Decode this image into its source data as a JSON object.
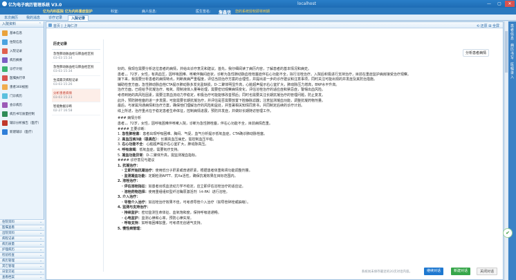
{
  "window": {
    "title": "亿为电子病历管理系统 V3.0",
    "host": "localhost",
    "controls": [
      "—",
      "▢",
      "✕"
    ]
  },
  "toolbar": {
    "org": "亿为内科医院 亿为内科重症监护",
    "ward_label": "科室:",
    "patient_label": "病人信息:",
    "doctor_label": "医生签名:",
    "user": "詹鑫信",
    "warning": "您的系统授权即将到期"
  },
  "tabs": [
    "本次病历",
    "我的消息",
    "诊疗记录",
    "入院记录"
  ],
  "sidebar": {
    "header": "入院资料",
    "items": [
      {
        "label": "基本信息",
        "color": "#e9a23b"
      },
      {
        "label": "住院信息",
        "color": "#4aa3df"
      },
      {
        "label": "入院记录",
        "color": "#e0604f"
      },
      {
        "label": "病历摘要",
        "color": "#7c5cc4"
      },
      {
        "label": "诊疗计划",
        "color": "#3cb371"
      },
      {
        "label": "医嘱执行单",
        "color": "#d9534f"
      },
      {
        "label": "患者360视图",
        "color": "#f0ad4e"
      },
      {
        "label": "门诊病历",
        "color": "#5bc0de"
      },
      {
        "label": "会诊病历",
        "color": "#9b59b6"
      },
      {
        "label": "病历书写质量控制",
        "color": "#2e8b57"
      },
      {
        "label": "辅诊分析报告（医疗）",
        "color": "#c0392b"
      },
      {
        "label": "新建辅诊（医疗）",
        "color": "#2f7ed8"
      }
    ],
    "sections": [
      "住院资料",
      "医嘱查看",
      "出院资料",
      "病程记录",
      "病历质量",
      "护理病历",
      "检验检查",
      "病历管理",
      "其它管理",
      "日常交班",
      "查看档案"
    ]
  },
  "main": {
    "breadcrumb": "首页 | 上海仁济",
    "right_actions": "⟲ 还原  ⊞ 全屏",
    "history_title": "历史记录",
    "history": [
      {
        "name": "急性肺动脉血栓与肺血栓区别",
        "time": "03-03 15:34"
      },
      {
        "name": "急性肺动脉血栓与肺血栓区别",
        "time": "03-03 15:34"
      },
      {
        "name": "生成最次病程记录",
        "time": "03-03 15:26"
      },
      {
        "name": "分析患者病情",
        "time": "03-03 15:23",
        "active": true
      },
      {
        "name": "智能数据诊断",
        "time": "02-27 16:58"
      }
    ],
    "prompt_tag": "分析患者病情",
    "reply": [
      "好的。我现在需要分析这位患者的病情，并给出诊疗意见和建议。首先，我仔细阅读了病历内容，了解患者的基本情况和病史。",
      "患者，，72岁，女性，有高血压，因呼吸困难、咳嗽伴胸闷症状，诊断为急性肺动脉血栓栓塞症伴右心功能不全，拟行溶栓治疗。入院后积极进行支持治疗，目前在重症监护病房接受治疗观察。",
      "接下来，我需要分析患者的病情特点，判断疾病严重程度，评估当前治疗方案的合理性，并提出进一步的诊疗建议和注意事项，同时关注可能出现的并发症及其防治措施。",
      "辅助检查方面，急性肺动脉血栓CTA提示肺动脉多发充盈缺损，D-二聚体明显升高，心脏超声提示右心室扩大，肺动脉压力增高，BNP水平升高。",
      "治疗方面，已经给予抗凝治疗、吸氧、限制液体入量等处理，需要密切观察病情变化，评估溶栓治疗的适应症和禁忌症，警惕出血风险。",
      "考虑到她的高风险因素，需要注意血流动力学稳定，积极治疗可能能够改善预后；同时也需要关注长期抗凝治疗的管理问题，防止复发。",
      "此外，预防肺栓塞的进一步发展，可能需要长期抗凝治疗，并评估是否需要放置下腔静脉滤器；注意监测凝血功能，调整抗凝药物剂量。",
      "最后，与家属沟通病情和治疗方案，确保他们理解治疗的风险和益处，并签署相关知情同意书，共同制定后续的诊疗计划。",
      "综上所述，治疗重点在于稳定患者生命体征，控制病情进展，预防并发症，并做好长期随访管理工作。"
    ],
    "analysis_title": "### 病情分析",
    "analysis_summary": "患者，，72岁，女性，因呼吸困难伴咳嗽入院，诊断为急性肺栓塞，伴右心功能不全，目前病情危重。",
    "key_title": "#### 主要诊断：",
    "key_points": [
      {
        "label": "急性肺栓塞",
        "text": "患者出现呼吸困难、胸闷、气促，血气分析提示低氧血症，CTA确诊肺动脉栓塞。"
      },
      {
        "label": "高血压病3级（极高危）",
        "text": "长期高血压病史，需控制血压平稳。"
      },
      {
        "label": "右心功能不全",
        "text": "心脏超声提示右心室扩大，肺动脉高压。"
      },
      {
        "label": "呼吸衰竭",
        "text": "低氧血症，需要氧疗支持。"
      },
      {
        "label": "凝血功能异常",
        "text": "D-二聚体升高，需监测凝血指标。"
      }
    ],
    "plan_title": "#### 诊疗意见与建议",
    "plan": [
      {
        "label": "1. 抗凝治疗：",
        "text": ""
      },
      {
        "label": "· 立即开始抗凝治疗：",
        "text": "使用低分子肝素或普通肝素，根据患者体重和肾功能调整剂量。"
      },
      {
        "label": "· 监测凝血功能：",
        "text": "定期检测APTT、抗Xa活性，确保抗凝效果在目标范围内。"
      },
      {
        "label": "2. 溶栓治疗：",
        "text": ""
      },
      {
        "label": "· 评估溶栓指征：",
        "text": "如患者出现血流动力学不稳定，应立即评估溶栓治疗的适应证。"
      },
      {
        "label": "· 溶栓药物选择：",
        "text": "使用重组组织型纤溶酶原激活剂（rt-PA）进行溶栓。"
      },
      {
        "label": "3. 介入治疗：",
        "text": ""
      },
      {
        "label": "· 导管介入治疗：",
        "text": "如溶栓治疗效果不佳，可考虑导管介入治疗（如导管碎栓或抽吸）。"
      },
      {
        "label": "4. 监测与支持治疗：",
        "text": ""
      },
      {
        "label": "· 持续监护：",
        "text": "密切监测生命体征、血氧饱和度，保持呼吸道通畅。"
      },
      {
        "label": "· 心电监护：",
        "text": "监测心律和心率，预防心律失常。"
      },
      {
        "label": "· 呼吸支持：",
        "text": "如呼吸困难加重，可考虑无创通气支持。"
      },
      {
        "label": "5. 慢性病管理：",
        "text": ""
      }
    ],
    "footer_hint": "系统尚未保存最近的20次对话内容。",
    "buttons": {
      "send": "继续对话",
      "new": "新建对话",
      "close": "关闭对话"
    }
  },
  "right_strip": [
    "患者信息",
    "病历书写",
    "医嘱录入"
  ]
}
